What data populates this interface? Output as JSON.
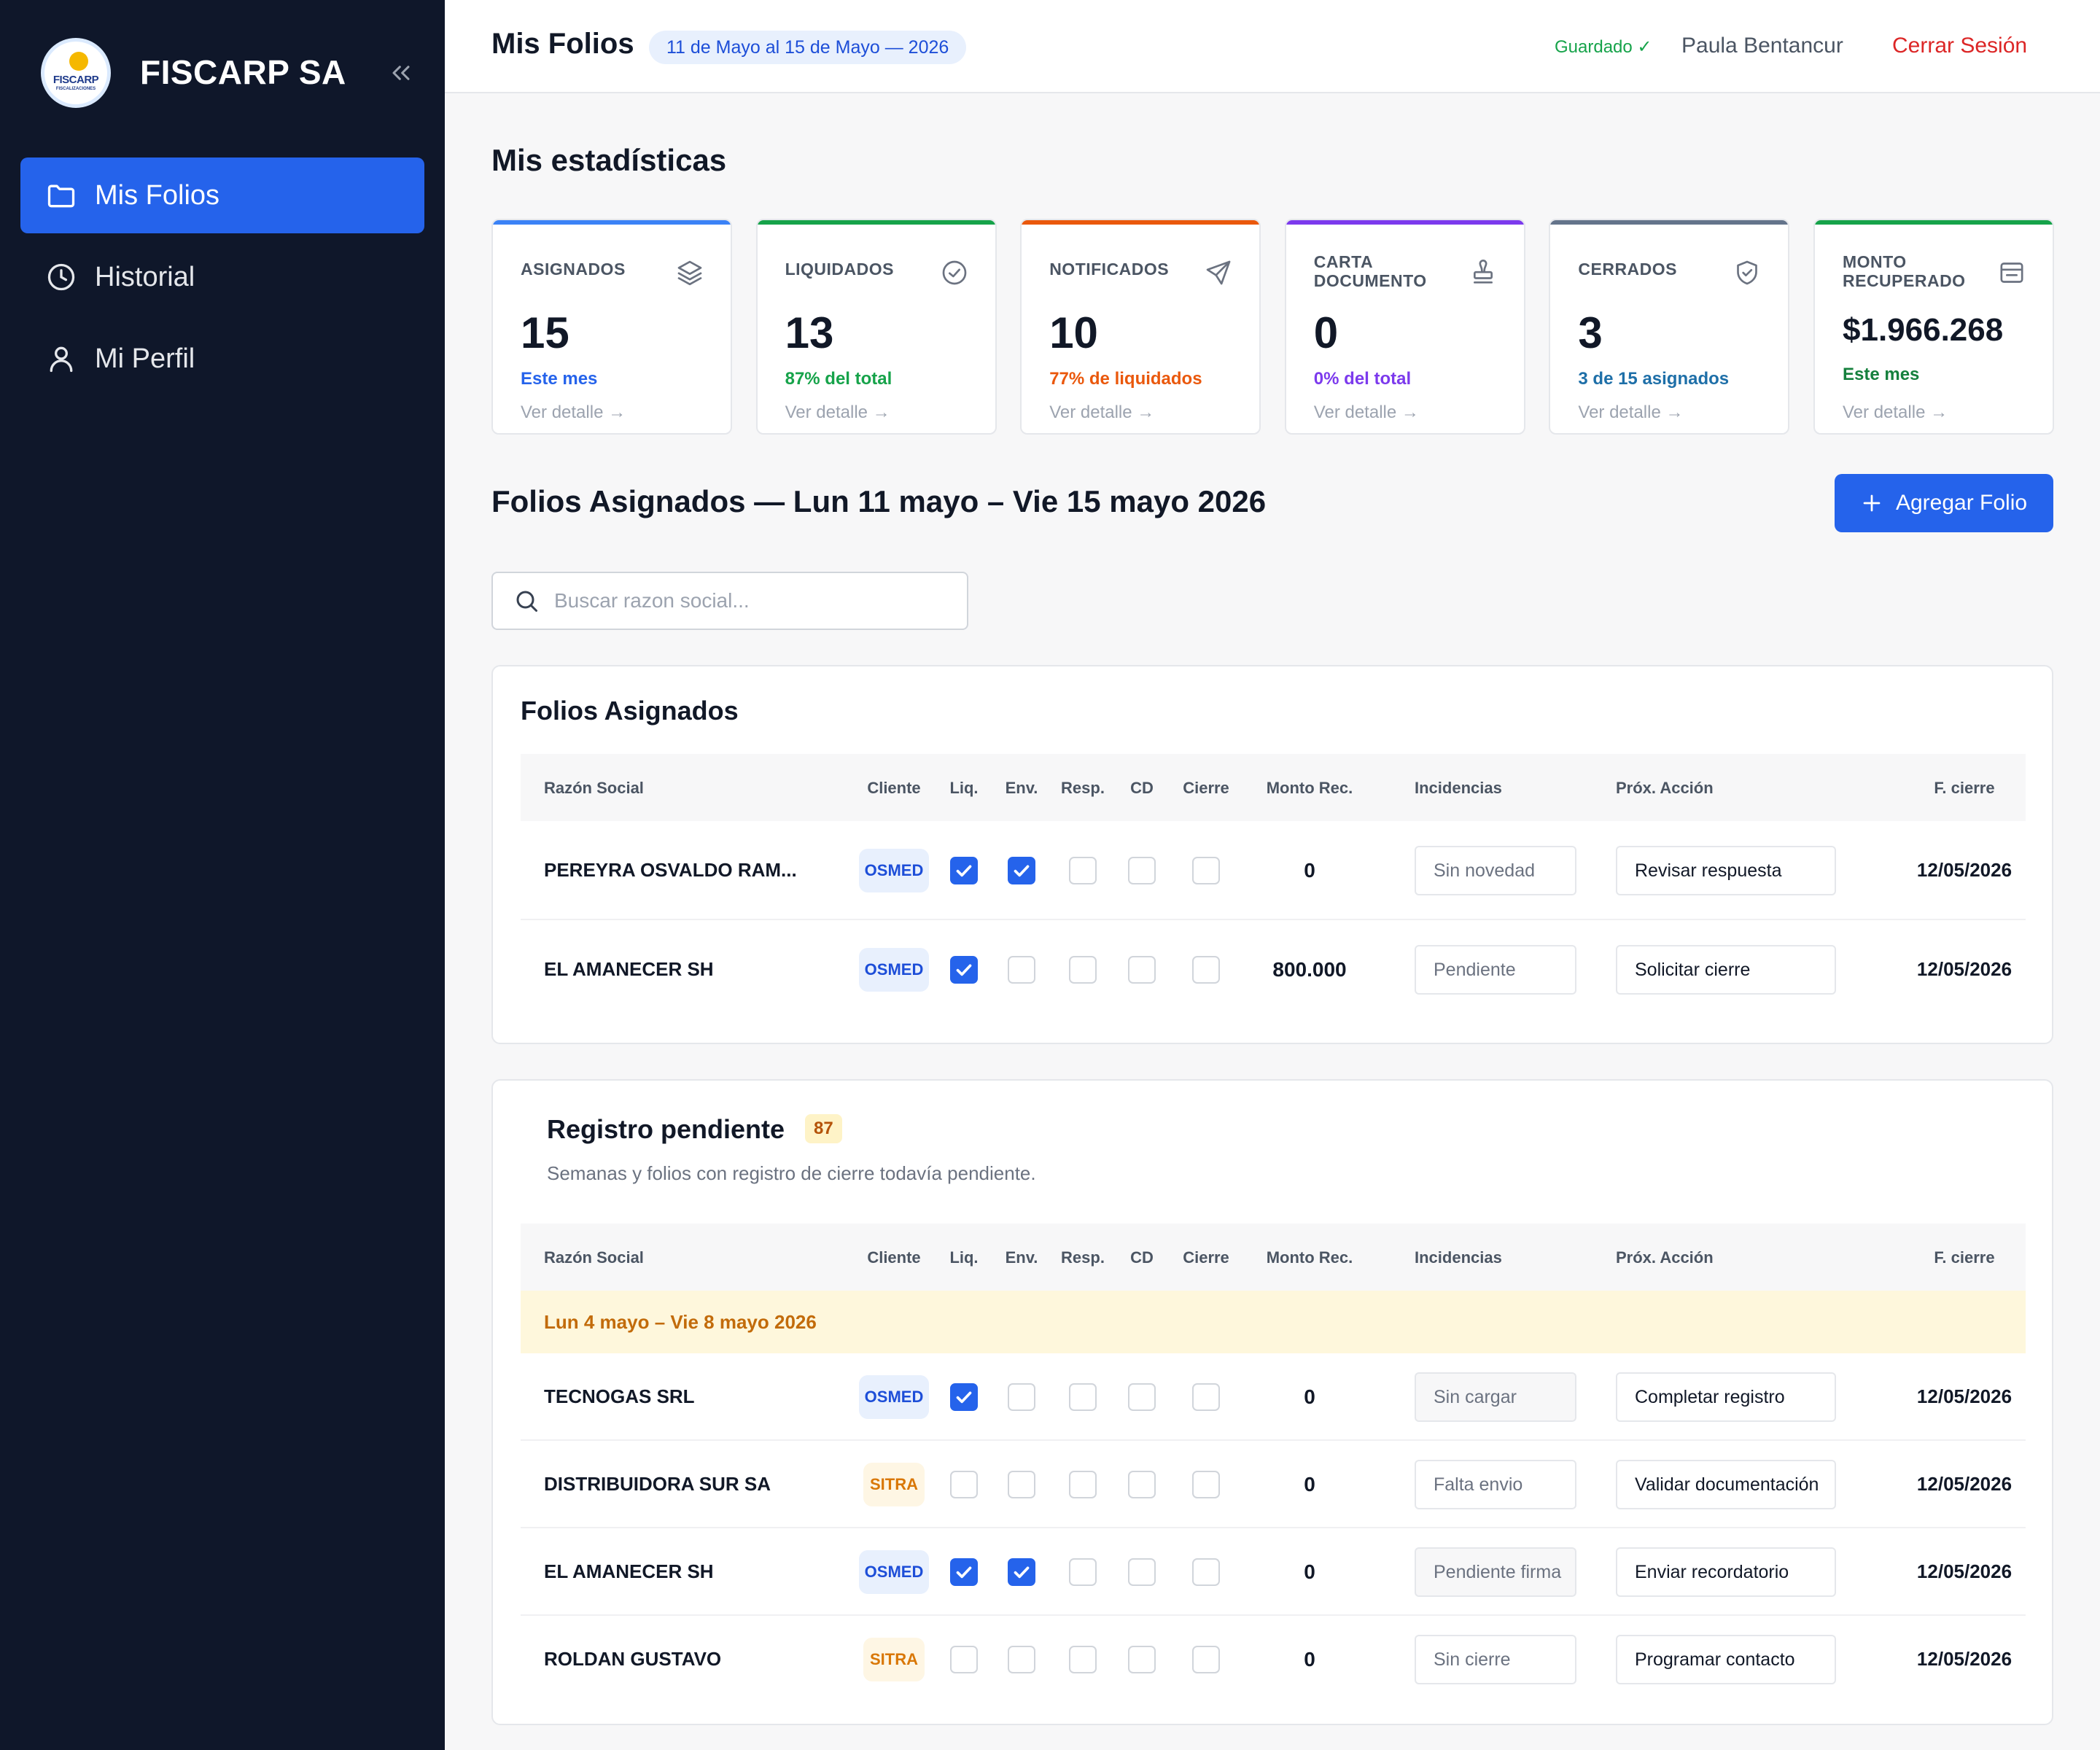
{
  "sidebar": {
    "logo_text": "FISCARP",
    "logo_sub": "FISCALIZACIONES",
    "brand": "FISCARP SA",
    "nav": [
      {
        "label": "Mis Folios",
        "icon": "folder-icon",
        "active": true
      },
      {
        "label": "Historial",
        "icon": "clock-icon",
        "active": false
      },
      {
        "label": "Mi Perfil",
        "icon": "user-icon",
        "active": false
      }
    ]
  },
  "header": {
    "title": "Mis Folios",
    "date_range": "11 de Mayo al 15 de Mayo — 2026",
    "saved": "Guardado ✓",
    "user": "Paula Bentancur",
    "logout": "Cerrar Sesión"
  },
  "stats": {
    "title": "Mis estadísticas",
    "cards": [
      {
        "label": "ASIGNADOS",
        "value": "15",
        "sub": "Este mes",
        "detail": "Ver detalle →",
        "color": "#3b82f6",
        "sub_color": "#2563eb",
        "icon": "layers-icon"
      },
      {
        "label": "LIQUIDADOS",
        "value": "13",
        "sub": "87% del total",
        "detail": "Ver detalle →",
        "color": "#16a34a",
        "sub_color": "#16a34a",
        "icon": "check-circle-icon"
      },
      {
        "label": "NOTIFICADOS",
        "value": "10",
        "sub": "77% de liquidados",
        "detail": "Ver detalle →",
        "color": "#ea580c",
        "sub_color": "#ea580c",
        "icon": "send-icon"
      },
      {
        "label": "CARTA DOCUMENTO",
        "value": "0",
        "sub": "0% del total",
        "detail": "Ver detalle →",
        "color": "#7c3aed",
        "sub_color": "#7c3aed",
        "icon": "stamp-icon"
      },
      {
        "label": "CERRADOS",
        "value": "3",
        "sub": "3 de 15 asignados",
        "detail": "Ver detalle →",
        "color": "#64748b",
        "sub_color": "#1e6fa8",
        "icon": "shield-check-icon"
      },
      {
        "label": "MONTO RECUPERADO",
        "value": "$1.966.268",
        "sub": "Este mes",
        "detail": "Ver detalle →",
        "color": "#16a34a",
        "sub_color": "#15803d",
        "icon": "inbox-icon"
      }
    ]
  },
  "folios": {
    "title": "Folios Asignados — Lun 11 mayo – Vie 15 mayo 2026",
    "add_label": "Agregar Folio",
    "search_placeholder": "Buscar razon social..."
  },
  "columns": [
    "Razón Social",
    "Cliente",
    "Liq.",
    "Env.",
    "Resp.",
    "CD",
    "Cierre",
    "Monto Rec.",
    "Incidencias",
    "Próx. Acción",
    "F. cierre"
  ],
  "assigned": {
    "title": "Folios Asignados",
    "rows": [
      {
        "razon": "PEREYRA OSVALDO RAM...",
        "cliente": "OSMED",
        "liq": true,
        "env": true,
        "resp": false,
        "cd": false,
        "cierre": false,
        "monto": "0",
        "incidencia": "Sin novedad",
        "accion": "Revisar respuesta",
        "fecha": "12/05/2026"
      },
      {
        "razon": "EL AMANECER SH",
        "cliente": "OSMED",
        "liq": true,
        "env": false,
        "resp": false,
        "cd": false,
        "cierre": false,
        "monto": "800.000",
        "incidencia": "Pendiente",
        "accion": "Solicitar cierre",
        "fecha": "12/05/2026"
      }
    ]
  },
  "pending": {
    "title": "Registro pendiente",
    "count": "87",
    "description": "Semanas y folios con registro de cierre todavía pendiente.",
    "week": "Lun 4 mayo – Vie 8 mayo 2026",
    "rows": [
      {
        "razon": "TECNOGAS SRL",
        "cliente": "OSMED",
        "liq": true,
        "env": false,
        "resp": false,
        "cd": false,
        "cierre": false,
        "monto": "0",
        "incidencia": "Sin cargar",
        "accion": "Completar registro",
        "fecha": "12/05/2026"
      },
      {
        "razon": "DISTRIBUIDORA SUR SA",
        "cliente": "SITRA",
        "liq": false,
        "env": false,
        "resp": false,
        "cd": false,
        "cierre": false,
        "monto": "0",
        "incidencia": "Falta envio",
        "accion": "Validar documentación",
        "fecha": "12/05/2026"
      },
      {
        "razon": "EL AMANECER SH",
        "cliente": "OSMED",
        "liq": true,
        "env": true,
        "resp": false,
        "cd": false,
        "cierre": false,
        "monto": "0",
        "incidencia": "Pendiente firma",
        "accion": "Enviar recordatorio",
        "fecha": "12/05/2026"
      },
      {
        "razon": "ROLDAN GUSTAVO",
        "cliente": "SITRA",
        "liq": false,
        "env": false,
        "resp": false,
        "cd": false,
        "cierre": false,
        "monto": "0",
        "incidencia": "Sin cierre",
        "accion": "Programar contacto",
        "fecha": "12/05/2026"
      }
    ]
  }
}
